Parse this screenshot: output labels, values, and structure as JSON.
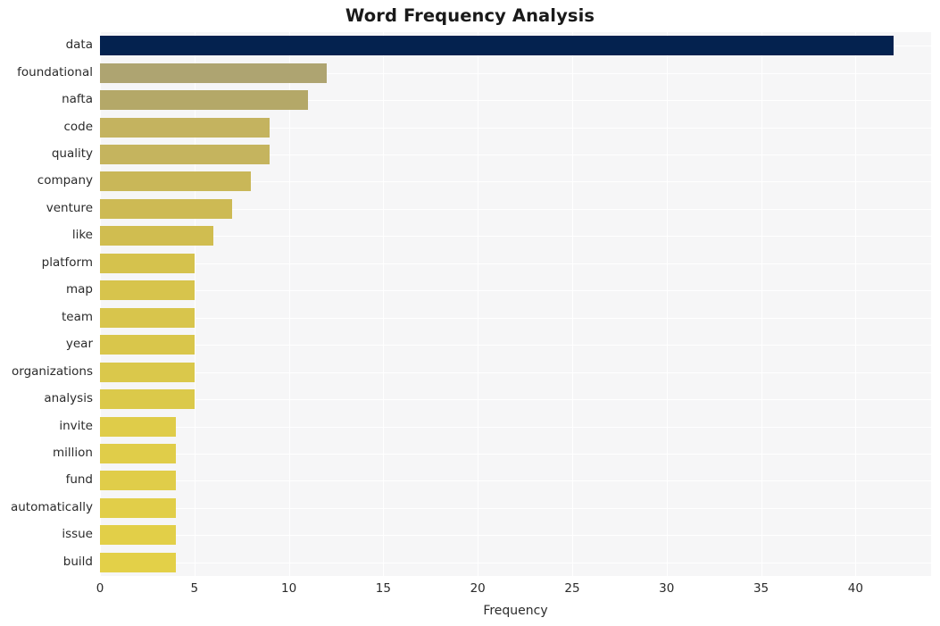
{
  "chart_data": {
    "type": "bar",
    "orientation": "horizontal",
    "title": "Word Frequency Analysis",
    "xlabel": "Frequency",
    "ylabel": "",
    "categories": [
      "data",
      "foundational",
      "nafta",
      "code",
      "quality",
      "company",
      "venture",
      "like",
      "platform",
      "map",
      "team",
      "year",
      "organizations",
      "analysis",
      "invite",
      "million",
      "fund",
      "automatically",
      "issue",
      "build"
    ],
    "values": [
      42,
      12,
      11,
      9,
      9,
      8,
      7,
      6,
      5,
      5,
      5,
      5,
      5,
      5,
      4,
      4,
      4,
      4,
      4,
      4
    ],
    "bar_colors": [
      "#04224f",
      "#aea471",
      "#b4a868",
      "#c4b35f",
      "#c5b45e",
      "#c9b758",
      "#cdba54",
      "#d0bd50",
      "#d5c24d",
      "#d7c44c",
      "#d8c54c",
      "#d9c64b",
      "#dac84b",
      "#dbc94a",
      "#dfcc49",
      "#e0cd49",
      "#e0cd49",
      "#e1ce49",
      "#e2cf48",
      "#e3d048"
    ],
    "xticks": [
      0,
      5,
      10,
      15,
      20,
      25,
      30,
      35,
      40
    ],
    "xlim": [
      0,
      44
    ],
    "grid": true,
    "legend": "none",
    "plot_background": "#f6f6f7",
    "gridline_color": "#ffffff",
    "title_color": "#1a1a1a",
    "tick_label_color": "#2b2b2b"
  }
}
